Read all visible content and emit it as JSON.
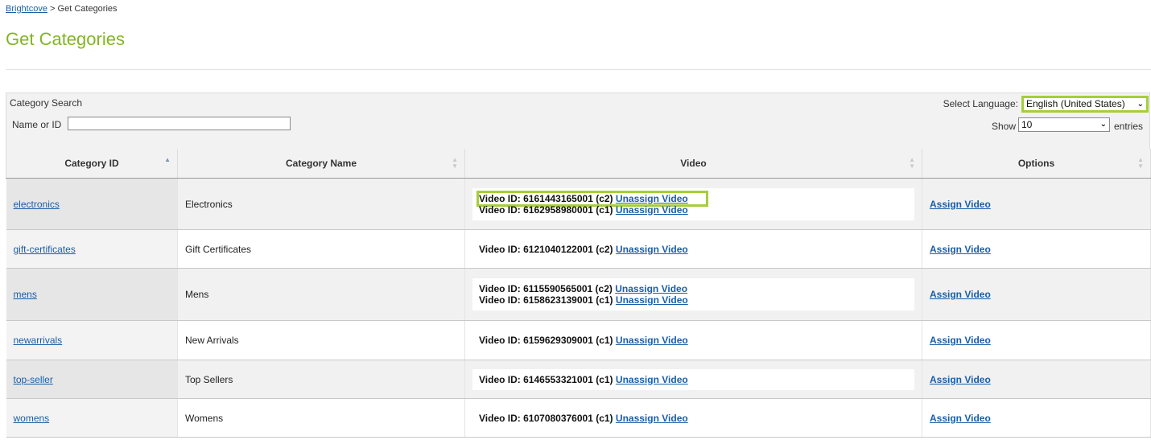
{
  "breadcrumb": {
    "root": "Brightcove",
    "separator": ">",
    "current": "Get Categories"
  },
  "page": {
    "title": "Get Categories"
  },
  "search": {
    "title": "Category Search",
    "name_label": "Name or ID",
    "name_value": "",
    "language_label": "Select Language:",
    "language_value": "English (United States)",
    "show_label": "Show",
    "entries_value": "10",
    "entries_label": "entries"
  },
  "table": {
    "columns": [
      "Category ID",
      "Category Name",
      "Video",
      "Options"
    ],
    "rows": [
      {
        "id": "electronics",
        "name": "Electronics",
        "option": "Assign Video",
        "videos": [
          {
            "text": "Video ID: 6161443165001 (c2)",
            "action": "Unassign Video"
          },
          {
            "text": "Video ID: 6162958980001 (c1)",
            "action": "Unassign Video"
          }
        ]
      },
      {
        "id": "gift-certificates",
        "name": "Gift Certificates",
        "option": "Assign Video",
        "videos": [
          {
            "text": "Video ID: 6121040122001 (c2)",
            "action": "Unassign Video"
          }
        ]
      },
      {
        "id": "mens",
        "name": "Mens",
        "option": "Assign Video",
        "videos": [
          {
            "text": "Video ID: 6115590565001 (c2)",
            "action": "Unassign Video"
          },
          {
            "text": "Video ID: 6158623139001 (c1)",
            "action": "Unassign Video"
          }
        ]
      },
      {
        "id": "newarrivals",
        "name": "New Arrivals",
        "option": "Assign Video",
        "videos": [
          {
            "text": "Video ID: 6159629309001 (c1)",
            "action": "Unassign Video"
          }
        ]
      },
      {
        "id": "top-seller",
        "name": "Top Sellers",
        "option": "Assign Video",
        "videos": [
          {
            "text": "Video ID: 6146553321001 (c1)",
            "action": "Unassign Video"
          }
        ]
      },
      {
        "id": "womens",
        "name": "Womens",
        "option": "Assign Video",
        "videos": [
          {
            "text": "Video ID: 6107080376001 (c1)",
            "action": "Unassign Video"
          }
        ]
      }
    ]
  },
  "colors": {
    "accent": "#82b523",
    "highlight": "#a6ce39",
    "link": "#1a5ea8"
  }
}
